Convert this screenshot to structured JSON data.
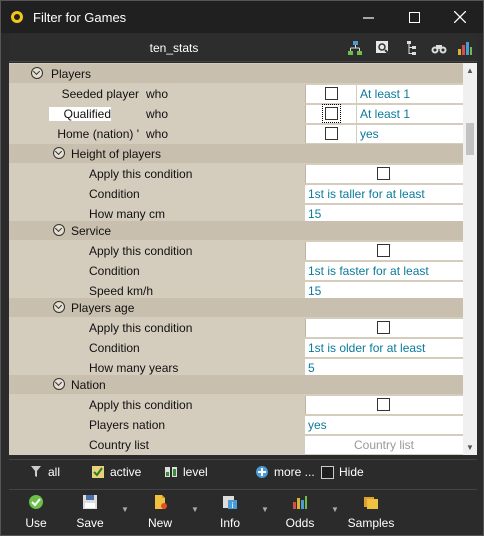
{
  "window": {
    "title": "Filter for Games"
  },
  "header": {
    "title": "ten_stats"
  },
  "grid": {
    "players": {
      "label": "Players",
      "rows": [
        {
          "label": "Seeded player",
          "who": "who",
          "value": "At least 1"
        },
        {
          "label": "Qualified",
          "who": "who",
          "value": "At least 1"
        },
        {
          "label": "Home (nation) '",
          "who": "who",
          "value": "yes"
        }
      ]
    },
    "height": {
      "label": "Height of players",
      "apply": "Apply this condition",
      "condition_label": "Condition",
      "condition_value": "1st is taller for at least",
      "amount_label": "How many cm",
      "amount_value": "15"
    },
    "service": {
      "label": "Service",
      "apply": "Apply this condition",
      "condition_label": "Condition",
      "condition_value": "1st is faster for at least",
      "amount_label": "Speed km/h",
      "amount_value": "15"
    },
    "age": {
      "label": "Players age",
      "apply": "Apply this condition",
      "condition_label": "Condition",
      "condition_value": "1st is older for at least",
      "amount_label": "How many years",
      "amount_value": "5"
    },
    "nation": {
      "label": "Nation",
      "apply": "Apply this condition",
      "players_nation_label": "Players nation",
      "players_nation_value": "yes",
      "country_list_label": "Country list",
      "country_list_placeholder": "Country list"
    }
  },
  "filterbar": {
    "all": "all",
    "active": "active",
    "level": "level",
    "more": "more ...",
    "hide": "Hide"
  },
  "actions": {
    "use": "Use",
    "save": "Save",
    "new": "New",
    "info": "Info",
    "odds": "Odds",
    "samples": "Samples"
  },
  "colors": {
    "grid_bg": "#d4ccbd",
    "value_text": "#0b7a9a",
    "window_bg": "#2b2b2b"
  }
}
